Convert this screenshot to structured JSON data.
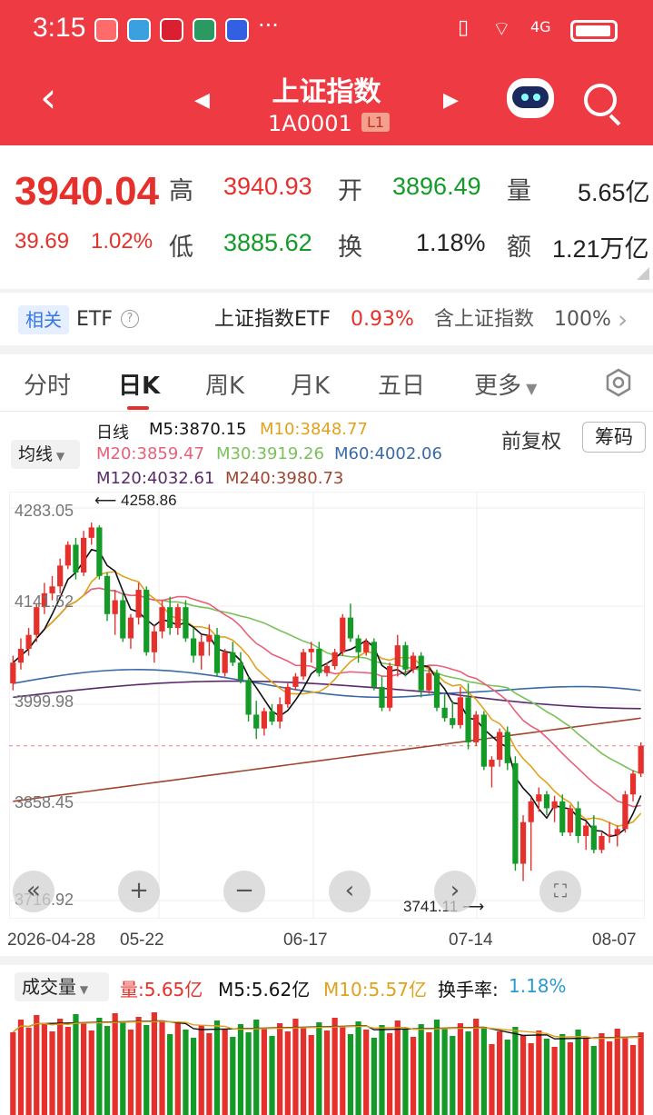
{
  "status": {
    "time": "3:15",
    "more": "···",
    "network": "4G"
  },
  "header": {
    "title": "上证指数",
    "code": "1A0001",
    "level": "L1"
  },
  "quote": {
    "price": "3940.04",
    "change": "39.69",
    "change_pct": "1.02%",
    "high_label": "高",
    "high": "3940.93",
    "low_label": "低",
    "low": "3885.62",
    "open_label": "开",
    "open": "3896.49",
    "turn_label": "换",
    "turnover_rate": "1.18%",
    "vol_label": "量",
    "volume": "5.65亿",
    "amt_label": "额",
    "amount": "1.21万亿"
  },
  "etf": {
    "tag": "相关",
    "label": "ETF",
    "name": "上证指数ETF",
    "pct": "0.93%",
    "hold_label": "含上证指数",
    "hold_pct": "100%"
  },
  "tabs": [
    "分时",
    "日K",
    "周K",
    "月K",
    "五日",
    "更多"
  ],
  "legend": {
    "chip": "均线",
    "type": "日线",
    "m5": "M5:3870.15",
    "m10": "M10:3848.77",
    "m20": "M20:3859.47",
    "m30": "M30:3919.26",
    "m60": "M60:4002.06",
    "m120": "M120:4032.61",
    "m240": "M240:3980.73",
    "adjust": "前复权",
    "chips_btn": "筹码"
  },
  "colors": {
    "up": "#e5302c",
    "down": "#139a27",
    "m5": "#111111",
    "m10": "#e0a21c",
    "m20": "#e8607a",
    "m30": "#79c25a",
    "m60": "#3a6aa6",
    "m120": "#5a2a6a",
    "m240": "#a0452e"
  },
  "chart_data": {
    "type": "candlestick",
    "ytick_labels": [
      "4283.05",
      "4141.52",
      "3999.98",
      "3858.45",
      "3716.92"
    ],
    "yticks": [
      4283.05,
      4141.52,
      3999.98,
      3858.45,
      3716.92
    ],
    "ylim": [
      3716.92,
      4283.05
    ],
    "xtick_labels": [
      "2026-04-28",
      "05-22",
      "06-17",
      "07-14",
      "08-07"
    ],
    "high_mark": "4258.86",
    "low_mark": "3741.11",
    "current_line": 3940.04,
    "ohlc": [
      [
        4030,
        4070,
        4020,
        4060
      ],
      [
        4060,
        4095,
        4050,
        4080
      ],
      [
        4080,
        4110,
        4070,
        4100
      ],
      [
        4100,
        4145,
        4090,
        4140
      ],
      [
        4140,
        4175,
        4130,
        4160
      ],
      [
        4160,
        4185,
        4150,
        4170
      ],
      [
        4170,
        4210,
        4160,
        4200
      ],
      [
        4200,
        4235,
        4195,
        4230
      ],
      [
        4230,
        4240,
        4180,
        4190
      ],
      [
        4190,
        4250,
        4185,
        4240
      ],
      [
        4240,
        4262,
        4230,
        4255
      ],
      [
        4255,
        4258,
        4180,
        4185
      ],
      [
        4185,
        4190,
        4120,
        4130
      ],
      [
        4130,
        4165,
        4100,
        4150
      ],
      [
        4150,
        4160,
        4090,
        4095
      ],
      [
        4095,
        4130,
        4080,
        4125
      ],
      [
        4125,
        4175,
        4115,
        4165
      ],
      [
        4165,
        4170,
        4070,
        4075
      ],
      [
        4075,
        4115,
        4060,
        4105
      ],
      [
        4105,
        4150,
        4095,
        4140
      ],
      [
        4140,
        4155,
        4100,
        4110
      ],
      [
        4110,
        4145,
        4100,
        4140
      ],
      [
        4140,
        4150,
        4090,
        4095
      ],
      [
        4095,
        4110,
        4060,
        4070
      ],
      [
        4070,
        4100,
        4050,
        4090
      ],
      [
        4090,
        4115,
        4070,
        4100
      ],
      [
        4100,
        4110,
        4040,
        4045
      ],
      [
        4045,
        4080,
        4040,
        4075
      ],
      [
        4075,
        4090,
        4055,
        4060
      ],
      [
        4060,
        4075,
        4030,
        4035
      ],
      [
        4035,
        4040,
        3975,
        3985
      ],
      [
        3985,
        4005,
        3950,
        3965
      ],
      [
        3965,
        3995,
        3955,
        3990
      ],
      [
        3990,
        4000,
        3970,
        3975
      ],
      [
        3975,
        4010,
        3965,
        4000
      ],
      [
        4000,
        4030,
        3995,
        4025
      ],
      [
        4025,
        4045,
        4020,
        4040
      ],
      [
        4040,
        4080,
        4035,
        4075
      ],
      [
        4075,
        4090,
        4060,
        4080
      ],
      [
        4080,
        4090,
        4040,
        4045
      ],
      [
        4045,
        4060,
        4040,
        4055
      ],
      [
        4055,
        4080,
        4050,
        4075
      ],
      [
        4075,
        4130,
        4070,
        4125
      ],
      [
        4125,
        4145,
        4090,
        4095
      ],
      [
        4095,
        4100,
        4060,
        4075
      ],
      [
        4075,
        4095,
        4070,
        4090
      ],
      [
        4090,
        4095,
        4020,
        4025
      ],
      [
        4025,
        4040,
        3990,
        3995
      ],
      [
        3995,
        4060,
        3990,
        4055
      ],
      [
        4055,
        4100,
        4040,
        4085
      ],
      [
        4085,
        4090,
        4040,
        4050
      ],
      [
        4050,
        4075,
        4045,
        4070
      ],
      [
        4070,
        4075,
        4010,
        4020
      ],
      [
        4020,
        4055,
        4015,
        4045
      ],
      [
        4045,
        4050,
        3990,
        3995
      ],
      [
        3995,
        4015,
        3975,
        3980
      ],
      [
        3980,
        4005,
        3965,
        3970
      ],
      [
        3970,
        4025,
        3965,
        4010
      ],
      [
        4010,
        4030,
        3935,
        3945
      ],
      [
        3945,
        3990,
        3940,
        3985
      ],
      [
        3985,
        3990,
        3905,
        3910
      ],
      [
        3910,
        3925,
        3880,
        3920
      ],
      [
        3920,
        3965,
        3910,
        3960
      ],
      [
        3960,
        3968,
        3905,
        3915
      ],
      [
        3915,
        3925,
        3760,
        3770
      ],
      [
        3770,
        3840,
        3745,
        3830
      ],
      [
        3830,
        3865,
        3760,
        3860
      ],
      [
        3860,
        3880,
        3845,
        3870
      ],
      [
        3870,
        3875,
        3840,
        3850
      ],
      [
        3850,
        3868,
        3830,
        3860
      ],
      [
        3860,
        3870,
        3810,
        3815
      ],
      [
        3815,
        3855,
        3810,
        3850
      ],
      [
        3850,
        3860,
        3800,
        3810
      ],
      [
        3810,
        3830,
        3790,
        3825
      ],
      [
        3825,
        3840,
        3785,
        3790
      ],
      [
        3790,
        3815,
        3785,
        3810
      ],
      [
        3810,
        3830,
        3800,
        3812
      ],
      [
        3812,
        3825,
        3795,
        3820
      ],
      [
        3820,
        3875,
        3815,
        3870
      ],
      [
        3870,
        3905,
        3860,
        3900
      ],
      [
        3900,
        3945,
        3895,
        3940
      ]
    ]
  },
  "volume": {
    "chip": "成交量",
    "vol": "量:5.65亿",
    "m5": "M5:5.62亿",
    "m10": "M10:5.57亿",
    "turn_label": "换手率:",
    "turn_val": "1.18%"
  }
}
